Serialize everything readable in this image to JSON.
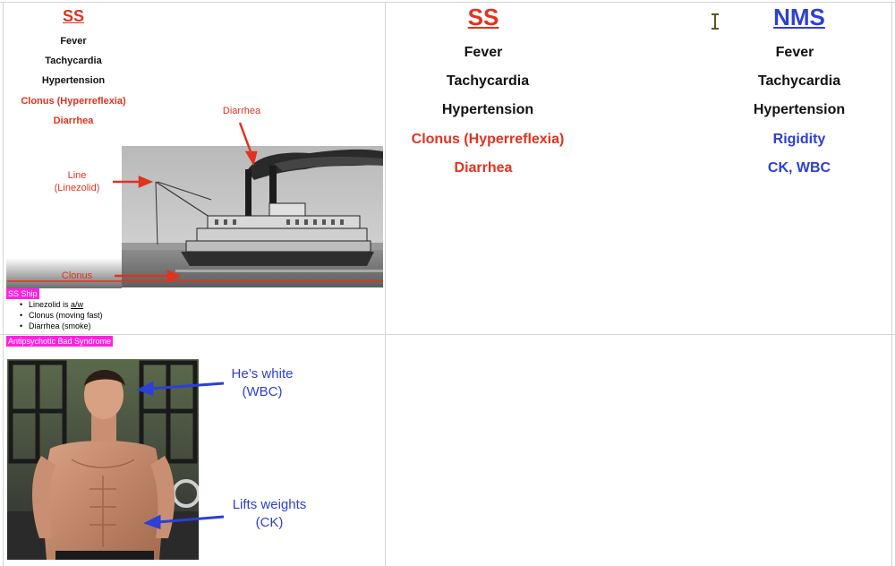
{
  "top_left": {
    "title": "SS",
    "items": [
      {
        "text": "Fever",
        "color": "#111111"
      },
      {
        "text": "Tachycardia",
        "color": "#111111"
      },
      {
        "text": "Hypertension",
        "color": "#111111"
      },
      {
        "text": "Clonus (Hyperreflexia)",
        "color": "#e1321f"
      },
      {
        "text": "Diarrhea",
        "color": "#e1321f"
      }
    ],
    "annotations": {
      "diarrhea": "Diarrhea",
      "line_1": "Line",
      "line_2": "(Linezolid)",
      "clonus": "Clonus"
    },
    "note_tag": "SS Ship",
    "notes": [
      {
        "prefix": "Linezolid is ",
        "underlined": "a/w"
      },
      {
        "prefix": "Clonus (moving fast)",
        "underlined": ""
      },
      {
        "prefix": "Diarrhea (smoke)",
        "underlined": ""
      }
    ]
  },
  "bottom_left": {
    "tag": "Antipsychotic Bad Syndrome",
    "annotation_1_line1": "He’s white",
    "annotation_1_line2": "(WBC)",
    "annotation_2_line1": "Lifts weights",
    "annotation_2_line2": "(CK)"
  },
  "top_right": {
    "ss_title": "SS",
    "nms_title": "NMS",
    "ss_items": [
      {
        "text": "Fever",
        "color": "#111111"
      },
      {
        "text": "Tachycardia",
        "color": "#111111"
      },
      {
        "text": "Hypertension",
        "color": "#111111"
      },
      {
        "text": "Clonus (Hyperreflexia)",
        "color": "#e1321f"
      },
      {
        "text": "Diarrhea",
        "color": "#e1321f"
      }
    ],
    "nms_items": [
      {
        "text": "Fever",
        "color": "#111111"
      },
      {
        "text": "Tachycardia",
        "color": "#111111"
      },
      {
        "text": "Hypertension",
        "color": "#111111"
      },
      {
        "text": "Rigidity",
        "color": "#2c3fd6"
      },
      {
        "text": "CK, WBC",
        "color": "#2c3fd6"
      }
    ]
  },
  "colors": {
    "red": "#e1321f",
    "blue": "#2c3fd6",
    "tag_magenta": "#ff21e2",
    "grid": "#d6d6d6"
  },
  "icons": {
    "cursor": "text-cursor-icon",
    "arrow": "arrow-icon"
  }
}
